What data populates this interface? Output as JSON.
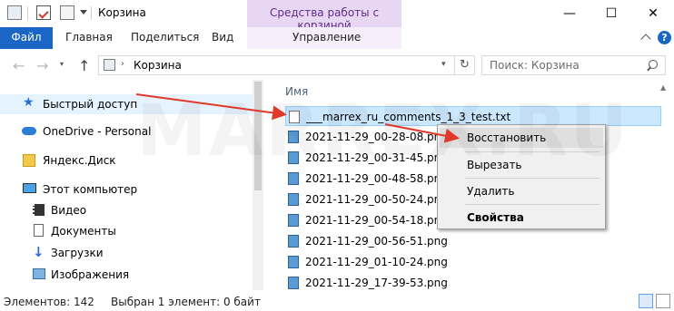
{
  "titlebar": {
    "title": "Корзина",
    "context_group_title": "Средства работы с корзиной",
    "minimize": "—",
    "maximize": "☐",
    "close": "✕"
  },
  "ribbon": {
    "tabs": [
      {
        "label": "Файл"
      },
      {
        "label": "Главная"
      },
      {
        "label": "Поделиться"
      },
      {
        "label": "Вид"
      },
      {
        "label": "Управление"
      }
    ],
    "collapse_icon": "chevron-up-icon",
    "help_icon": "help-icon"
  },
  "address": {
    "path": "Корзина",
    "refresh": "↻",
    "search_placeholder": "Поиск: Корзина"
  },
  "navigation": {
    "items": [
      {
        "label": "Быстрый доступ",
        "icon": "star-icon"
      },
      {
        "label": "OneDrive - Personal",
        "icon": "cloud-icon"
      },
      {
        "label": "Яндекс.Диск",
        "icon": "yandex-disk-icon"
      },
      {
        "label": "Этот компьютер",
        "icon": "computer-icon"
      },
      {
        "label": "Видео",
        "icon": "video-icon"
      },
      {
        "label": "Документы",
        "icon": "documents-icon"
      },
      {
        "label": "Загрузки",
        "icon": "download-icon"
      },
      {
        "label": "Изображения",
        "icon": "pictures-icon"
      }
    ]
  },
  "filelist": {
    "column_header": "Имя",
    "files": [
      {
        "name": "___marrex_ru_comments_1_3_test.txt",
        "type": "txt",
        "selected": true
      },
      {
        "name": "2021-11-29_00-28-08.png",
        "type": "png"
      },
      {
        "name": "2021-11-29_00-31-45.png",
        "type": "png"
      },
      {
        "name": "2021-11-29_00-48-58.png",
        "type": "png"
      },
      {
        "name": "2021-11-29_00-50-24.png",
        "type": "png"
      },
      {
        "name": "2021-11-29_00-54-18.png",
        "type": "png"
      },
      {
        "name": "2021-11-29_00-56-51.png",
        "type": "png"
      },
      {
        "name": "2021-11-29_01-10-24.png",
        "type": "png"
      },
      {
        "name": "2021-11-29_17-39-53.png",
        "type": "png"
      }
    ]
  },
  "context_menu": {
    "items": [
      {
        "label": "Восстановить",
        "highlighted": true
      },
      {
        "label": "Вырезать"
      },
      {
        "label": "Удалить"
      },
      {
        "label": "Свойства",
        "bold": true
      }
    ]
  },
  "status": {
    "items_count": "Элементов: 142",
    "selection": "Выбран 1 элемент: 0 байт"
  },
  "watermark": "MARREX.RU",
  "colors": {
    "accent": "#1a66c6",
    "context_tab": "#e7d7f3",
    "selection": "#cce8ff",
    "arrow": "#e0392b"
  }
}
